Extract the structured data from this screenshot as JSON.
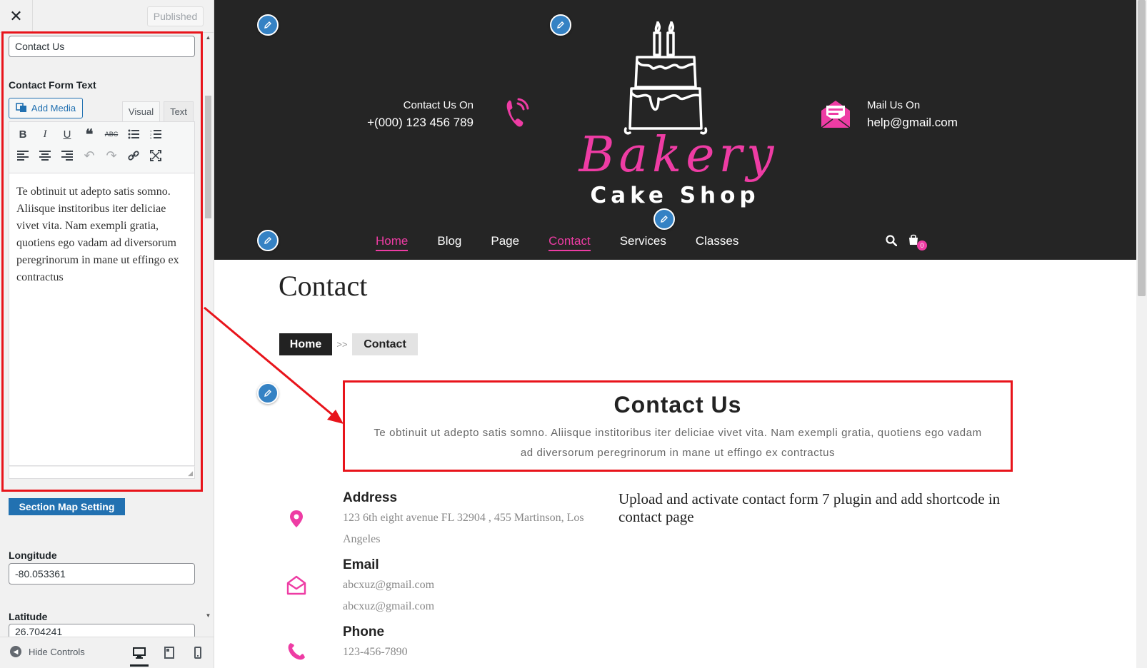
{
  "sidebar": {
    "close_icon": "close-icon",
    "published_label": "Published",
    "title_value": "Contact Us",
    "contact_form_text_label": "Contact Form Text",
    "add_media_label": "Add Media",
    "tab_visual": "Visual",
    "tab_text": "Text",
    "editor_content": "Te obtinuit ut adepto satis somno. Aliisque institoribus iter deliciae vivet vita. Nam exempli gratia, quotiens ego vadam ad diversorum peregrinorum in mane ut effingo ex contractus",
    "section_map_label": "Section Map Setting",
    "longitude_label": "Longitude",
    "longitude_value": "-80.053361",
    "latitude_label": "Latitude",
    "latitude_value": "26.704241",
    "hide_controls_label": "Hide Controls",
    "toolbar_icons": [
      "bold-icon",
      "italic-icon",
      "underline-icon",
      "blockquote-icon",
      "strikethrough-icon",
      "bullet-list-icon",
      "numbered-list-icon",
      "align-left-icon",
      "align-center-icon",
      "align-right-icon",
      "undo-icon",
      "redo-icon",
      "link-icon",
      "fullscreen-icon"
    ]
  },
  "header": {
    "contact_on_label": "Contact Us On",
    "contact_phone": "+(000) 123 456 789",
    "mail_on_label": "Mail Us On",
    "mail_address": "help@gmail.com",
    "logo_bakery": "Bakery",
    "logo_cakeshop": "Cake Shop",
    "nav": [
      "Home",
      "Blog",
      "Page",
      "Contact",
      "Services",
      "Classes"
    ],
    "nav_active": [
      "Home",
      "Contact"
    ],
    "cart_count": "0"
  },
  "page": {
    "title": "Contact",
    "breadcrumb_home": "Home",
    "breadcrumb_sep": ">>",
    "breadcrumb_current": "Contact",
    "contact_heading": "Contact Us",
    "contact_desc": "Te obtinuit ut adepto satis somno. Aliisque institoribus iter deliciae vivet vita. Nam exempli gratia, quotiens ego vadam ad diversorum peregrinorum in mane ut effingo ex contractus",
    "address_title": "Address",
    "address_text": "123 6th eight avenue FL 32904 , 455 Martinson, Los Angeles",
    "email_title": "Email",
    "email_1": "abcxuz@gmail.com",
    "email_2": "abcxuz@gmail.com",
    "phone_title": "Phone",
    "phone_text": "123-456-7890",
    "plugin_note": "Upload and activate contact form 7 plugin and add shortcode in contact page"
  },
  "colors": {
    "accent_pink": "#ee3ca4",
    "header_bg": "#252525",
    "highlight_red": "#e8141b",
    "wp_blue": "#2271b1",
    "edit_pencil_blue": "#3582c4"
  }
}
